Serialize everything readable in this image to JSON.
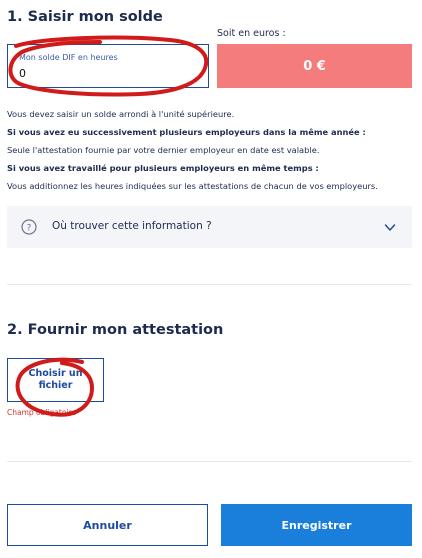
{
  "section1": {
    "title": "1. Saisir mon solde",
    "euros_label": "Soit en euros :",
    "input": {
      "label": "Mon solde DIF en heures",
      "value": "0"
    },
    "euros_value": "0 €",
    "info_lines": [
      "Vous devez saisir un solde arrondi à l'unité supérieure.",
      "Si vous avez eu successivement plusieurs employeurs dans la même année :",
      "Seule l'attestation fournie par votre dernier employeur en date est valable.",
      "Si vous avez travaillé pour plusieurs employeurs en même temps :",
      "Vous additionnez les heures indiquées sur les attestations de chacun de vos employeurs."
    ],
    "accordion": {
      "label": "Où trouver cette information ?",
      "help_icon": "?"
    }
  },
  "section2": {
    "title": "2. Fournir mon attestation",
    "file_button": "Choisir un fichier",
    "error": "Champ obligatoire"
  },
  "footer": {
    "cancel_label": "Annuler",
    "save_label": "Enregistrer"
  },
  "colors": {
    "primary": "#1a7fdb",
    "euro_box": "#f47c7c",
    "annotation": "#d11a1a",
    "error": "#d13438"
  }
}
